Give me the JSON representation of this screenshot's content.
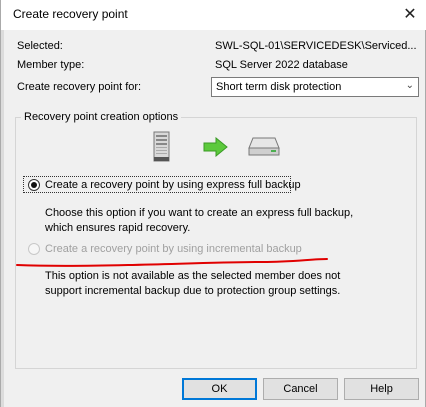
{
  "window": {
    "title": "Create recovery point",
    "close_icon": "close-icon"
  },
  "info": {
    "selected_label": "Selected:",
    "selected_value": "SWL-SQL-01\\SERVICEDESK\\Serviced...",
    "member_type_label": "Member type:",
    "member_type_value": "SQL Server 2022 database",
    "create_for_label": "Create recovery point for:",
    "create_for_value": "Short term disk protection"
  },
  "options_group": {
    "title": "Recovery point creation options",
    "icons": [
      "server-icon",
      "arrow-right-icon",
      "disk-drive-icon"
    ],
    "express": {
      "label": "Create a recovery point by using express full backup",
      "description": "Choose this option if you want to create an express full backup, which ensures rapid recovery.",
      "selected": true
    },
    "incremental": {
      "label": "Create a recovery point by using incremental backup",
      "description": "This option is not available as the selected member does not support incremental backup due to protection group settings.",
      "selected": false,
      "enabled": false
    }
  },
  "buttons": {
    "ok": "OK",
    "cancel": "Cancel",
    "help": "Help"
  },
  "colors": {
    "accent": "#0078d7",
    "annotation": "#e00000",
    "arrow": "#5cc93c"
  }
}
